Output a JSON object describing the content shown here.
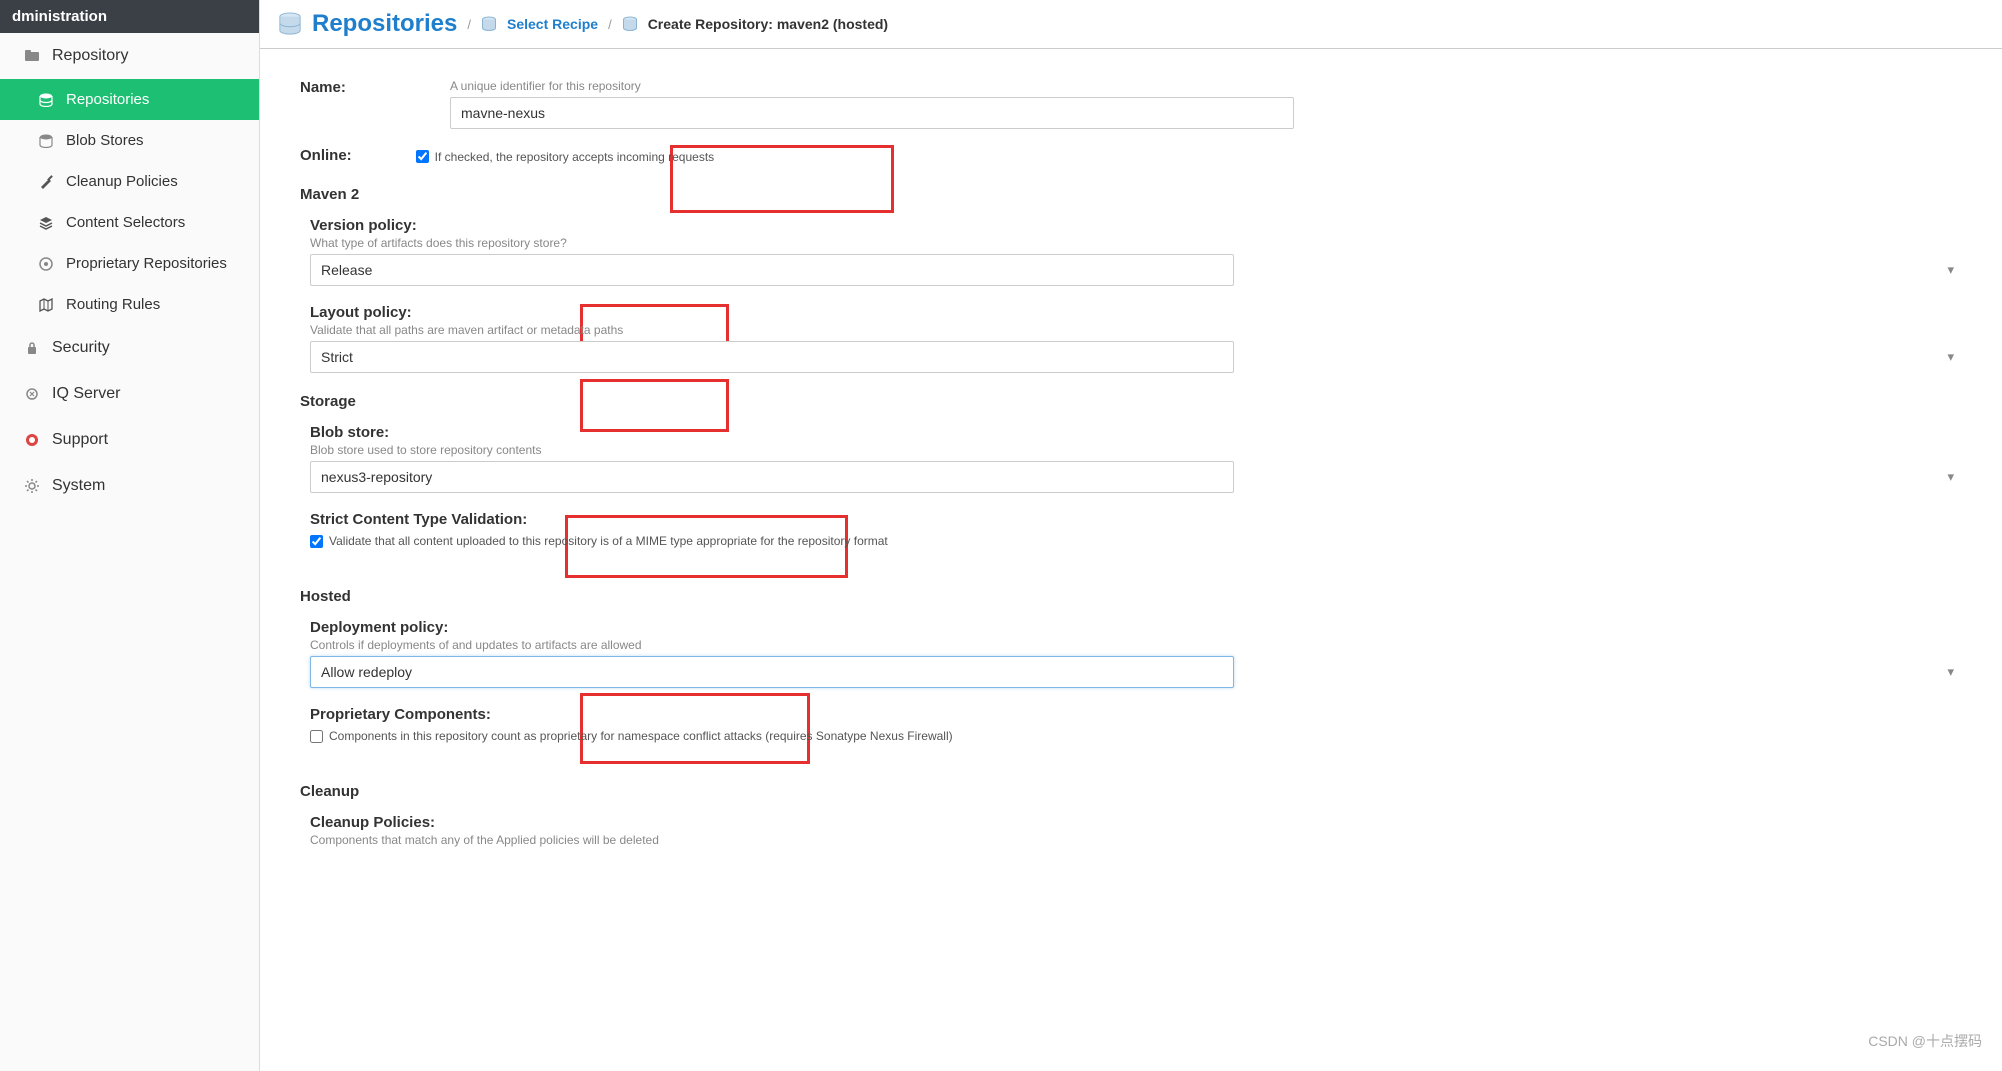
{
  "sidebar": {
    "header": "dministration",
    "section_repository": "Repository",
    "items": [
      {
        "label": "Repositories",
        "icon": "database-icon"
      },
      {
        "label": "Blob Stores",
        "icon": "database-icon"
      },
      {
        "label": "Cleanup Policies",
        "icon": "brush-icon"
      },
      {
        "label": "Content Selectors",
        "icon": "layers-icon"
      },
      {
        "label": "Proprietary Repositories",
        "icon": "proprietary-icon"
      },
      {
        "label": "Routing Rules",
        "icon": "map-icon"
      }
    ],
    "section_security": "Security",
    "section_iq": "IQ Server",
    "section_support": "Support",
    "section_system": "System"
  },
  "breadcrumb": {
    "title": "Repositories",
    "link": "Select Recipe",
    "current": "Create Repository: maven2 (hosted)"
  },
  "form": {
    "name_label": "Name:",
    "name_hint": "A unique identifier for this repository",
    "name_value": "mavne-nexus",
    "online_label": "Online:",
    "online_hint": "If checked, the repository accepts incoming requests",
    "maven_section": "Maven 2",
    "version_label": "Version policy:",
    "version_hint": "What type of artifacts does this repository store?",
    "version_value": "Release",
    "layout_label": "Layout policy:",
    "layout_hint": "Validate that all paths are maven artifact or metadata paths",
    "layout_value": "Strict",
    "storage_section": "Storage",
    "blob_label": "Blob store:",
    "blob_hint": "Blob store used to store repository contents",
    "blob_value": "nexus3-repository",
    "strict_label": "Strict Content Type Validation:",
    "strict_hint": "Validate that all content uploaded to this repository is of a MIME type appropriate for the repository format",
    "hosted_section": "Hosted",
    "deploy_label": "Deployment policy:",
    "deploy_hint": "Controls if deployments of and updates to artifacts are allowed",
    "deploy_value": "Allow redeploy",
    "proprietary_label": "Proprietary Components:",
    "proprietary_hint": "Components in this repository count as proprietary for namespace conflict attacks (requires Sonatype Nexus Firewall)",
    "cleanup_section": "Cleanup",
    "cleanup_label": "Cleanup Policies:",
    "cleanup_hint": "Components that match any of the Applied policies will be deleted"
  },
  "watermark": "CSDN @十点摆码"
}
